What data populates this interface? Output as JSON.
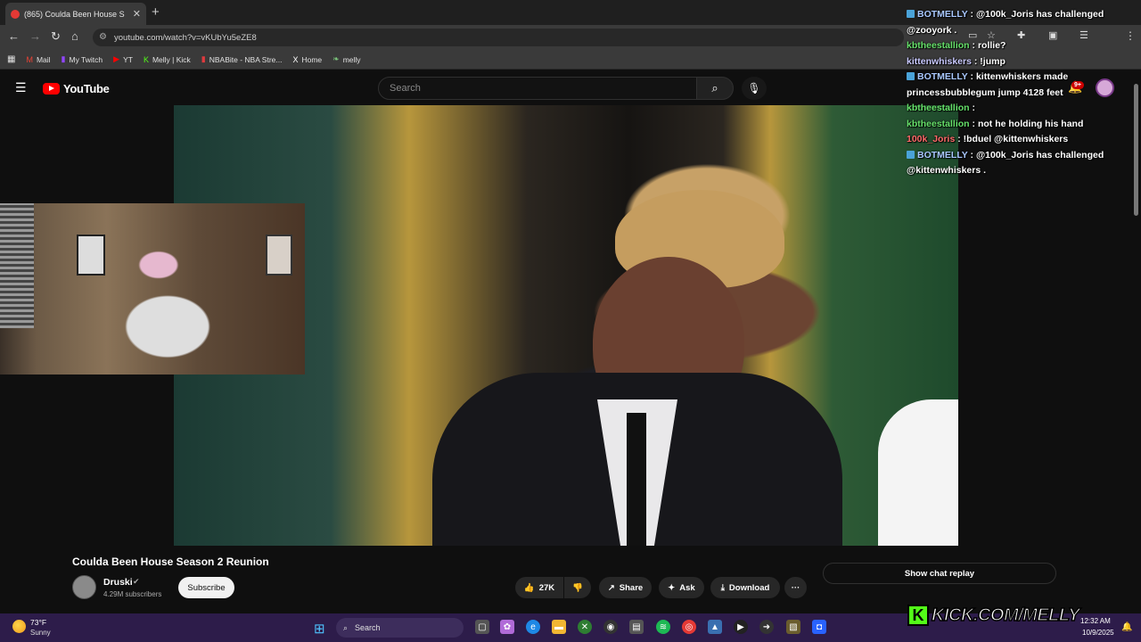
{
  "browser": {
    "tab_title": "(865) Coulda Been House S",
    "tab_close": "✕",
    "new_tab": "+",
    "url": "youtube.com/watch?v=vKUbYu5eZE8",
    "bookmarks": [
      {
        "label": "Mail",
        "icon": "gmail-icon",
        "glyph": "M",
        "color": "#ea4335"
      },
      {
        "label": "My Twitch",
        "icon": "twitch-icon",
        "glyph": "▮",
        "color": "#9146ff"
      },
      {
        "label": "YT",
        "icon": "youtube-icon",
        "glyph": "▶",
        "color": "#ff0000"
      },
      {
        "label": "Melly | Kick",
        "icon": "kick-icon",
        "glyph": "K",
        "color": "#53fc18"
      },
      {
        "label": "NBABite - NBA Stre...",
        "icon": "nba-icon",
        "glyph": "▮",
        "color": "#e03a3e"
      },
      {
        "label": "Home",
        "icon": "x-icon",
        "glyph": "X",
        "color": "#ffffff"
      },
      {
        "label": "melly",
        "icon": "leaf-icon",
        "glyph": "❧",
        "color": "#7cc77c"
      }
    ]
  },
  "youtube": {
    "logo_text": "YouTube",
    "search_placeholder": "Search",
    "notification_count": "9+"
  },
  "video": {
    "title": "Coulda Been House Season 2 Reunion",
    "channel": "Druski",
    "subscribers": "4.29M subscribers",
    "subscribe_label": "Subscribe",
    "likes": "27K",
    "share_label": "Share",
    "ask_label": "Ask",
    "download_label": "Download",
    "more_label": "···",
    "chat_replay_label": "Show chat replay"
  },
  "chat": [
    {
      "user": "BOTMELLY",
      "cls": "cu-bot",
      "badge": true,
      "text": "@100k_Joris has challenged @zooyork ."
    },
    {
      "user": "kbtheestallion",
      "cls": "cu-kb",
      "badge": false,
      "text": "rollie?"
    },
    {
      "user": "kittenwhiskers",
      "cls": "cu-kit",
      "badge": false,
      "text": "!jump"
    },
    {
      "user": "BOTMELLY",
      "cls": "cu-bot",
      "badge": true,
      "text": "kittenwhiskers made princessbubblegum jump 4128 feet"
    },
    {
      "user": "kbtheestallion",
      "cls": "cu-kb",
      "badge": false,
      "text": ""
    },
    {
      "user": "kbtheestallion",
      "cls": "cu-kb",
      "badge": false,
      "text": "not he holding his hand"
    },
    {
      "user": "100k_Joris",
      "cls": "cu-joris",
      "badge": false,
      "text": "!bduel @kittenwhiskers"
    },
    {
      "user": "BOTMELLY",
      "cls": "cu-bot",
      "badge": true,
      "text": "@100k_Joris has challenged @kittenwhiskers ."
    }
  ],
  "taskbar": {
    "temperature": "73°F",
    "condition": "Sunny",
    "search_label": "Search",
    "time": "12:32 AM",
    "date": "10/9/2025"
  },
  "overlay": {
    "kick_letter": "K",
    "kick_text": "KICK.COM/MELLY"
  }
}
